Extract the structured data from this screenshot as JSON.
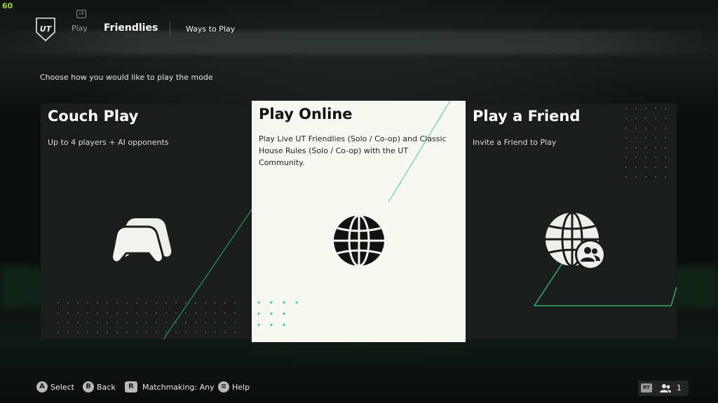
{
  "overlay": {
    "fps": "60"
  },
  "header": {
    "logo_text": "UT",
    "bumper_hint": "LB",
    "nav_play": "Play",
    "nav_current": "Friendlies",
    "nav_next": "Ways to Play"
  },
  "subtitle": "Choose how you would like to play the mode",
  "cards": [
    {
      "title": "Couch Play",
      "description": "Up to 4 players + AI opponents",
      "icon": "controllers-icon"
    },
    {
      "title": "Play Online",
      "description": "Play Live UT Friendlies (Solo / Co-op) and Classic House Rules (Solo / Co-op) with the UT Community.",
      "icon": "globe-icon",
      "selected": true
    },
    {
      "title": "Play a Friend",
      "description": "Invite a Friend to Play",
      "icon": "globe-friends-icon"
    }
  ],
  "footer": {
    "select_btn": "A",
    "select_label": "Select",
    "back_btn": "B",
    "back_label": "Back",
    "matchmaking_btn": "R",
    "matchmaking_label": "Matchmaking: Any",
    "help_btn": "≡",
    "help_label": "Help",
    "rt_btn": "RT",
    "friends_count": "1"
  },
  "colors": {
    "accent": "#2ad17a",
    "card_dark": "#1b1d1c",
    "card_selected": "#f7f8f1",
    "fps": "#9bdc30"
  }
}
